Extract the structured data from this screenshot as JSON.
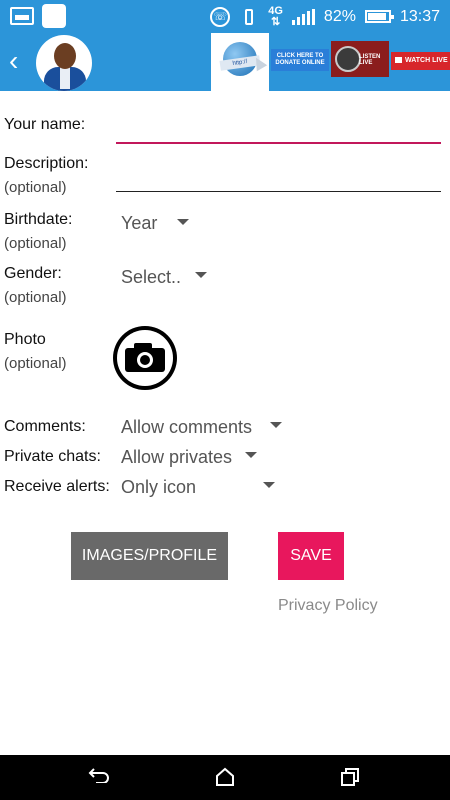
{
  "status_bar": {
    "battery": "82%",
    "time": "13:37",
    "network": "4G"
  },
  "header": {
    "back_icon": "chevron-left-icon",
    "banner_donate_text": "CLICK HERE TO DONATE ONLINE",
    "banner_listen_text": "LISTEN LIVE",
    "banner_watch_text": "WATCH LIVE"
  },
  "form": {
    "name_label": "Your name:",
    "description_label": "Description:",
    "description_optional": "(optional)",
    "birthdate_label": "Birthdate:",
    "birthdate_optional": "(optional)",
    "birthdate_value": "Year",
    "gender_label": "Gender:",
    "gender_optional": "(optional)",
    "gender_value": "Select..",
    "photo_label": "Photo",
    "photo_optional": "(optional)",
    "comments_label": "Comments:",
    "comments_value": "Allow comments",
    "private_chats_label": "Private chats:",
    "private_chats_value": "Allow privates",
    "alerts_label": "Receive alerts:",
    "alerts_value": "Only icon"
  },
  "actions": {
    "images_profile_label": "IMAGES/PROFILE",
    "save_label": "SAVE",
    "privacy_label": "Privacy Policy"
  },
  "colors": {
    "accent": "#2c95d9",
    "save": "#e8175d",
    "images_btn": "#696969",
    "name_underline": "#c2185b"
  }
}
